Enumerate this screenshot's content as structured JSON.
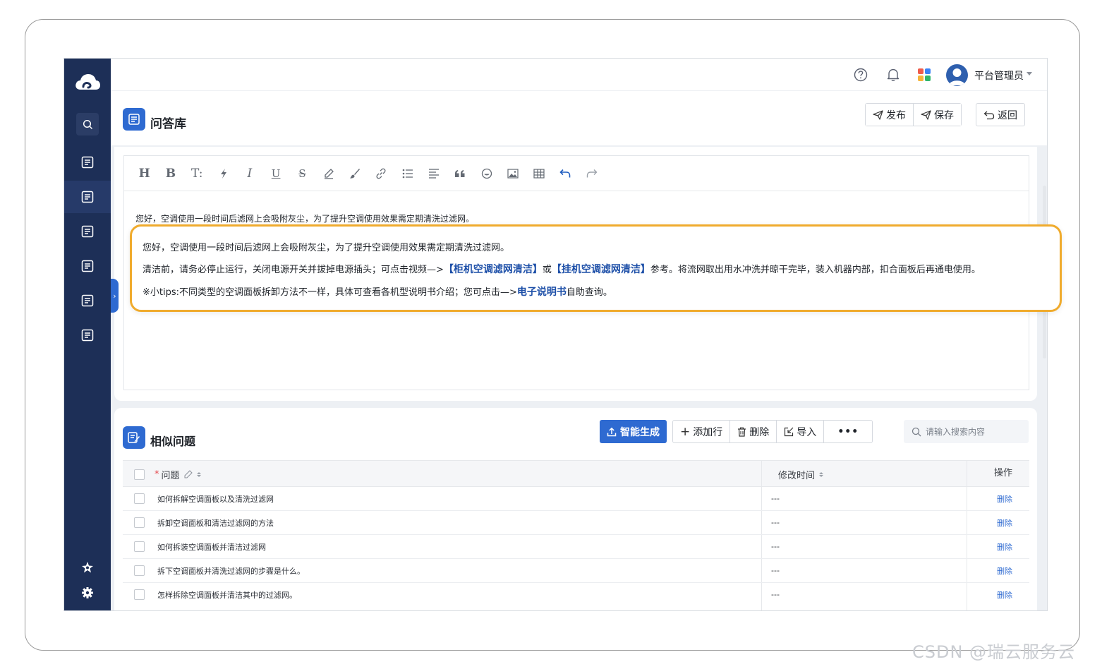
{
  "header": {
    "user_name": "平台管理员",
    "apps_colors": [
      "#ef5b4b",
      "#3b82f6",
      "#f5b43a",
      "#2fb56b"
    ]
  },
  "page": {
    "title": "问答库",
    "publish_label": "发布",
    "save_label": "保存",
    "back_label": "返回"
  },
  "editor": {
    "tools": [
      "H",
      "B",
      "T:",
      "",
      "I",
      "U",
      "S",
      "",
      "",
      "",
      "",
      "",
      "",
      "",
      "",
      "",
      "",
      ""
    ],
    "line1": "您好，空调使用一段时间后滤网上会吸附灰尘，为了提升空调使用效果需定期清洗过滤网。"
  },
  "callout": {
    "line1": "您好，空调使用一段时间后滤网上会吸附灰尘，为了提升空调使用效果需定期清洗过滤网。",
    "line2_pre": "清洁前，请务必停止运行，关闭电源开关并拔掉电源插头；可点击视频—>",
    "line2_link1": "【柜机空调滤网清洁】",
    "line2_mid": "或",
    "line2_link2": "【挂机空调滤网清洁】",
    "line2_post": "参考。将流网取出用水冲洗并晾干完毕，装入机器内部，扣合面板后再通电使用。",
    "line3_pre": "※小tips:不同类型的空调面板拆卸方法不一样，具体可查看各机型说明书介绍；您可点击—>",
    "line3_link": "电子说明书",
    "line3_post": "自助查询。"
  },
  "similar": {
    "title": "相似问题",
    "generate_label": "智能生成",
    "add_row_label": "添加行",
    "delete_label": "删除",
    "import_label": "导入",
    "more_label": "•••",
    "search_placeholder": "请输入搜索内容",
    "columns": {
      "required_mark": "*",
      "question": "问题",
      "modified": "修改时间",
      "action": "操作"
    },
    "rows": [
      {
        "question": "如何拆解空调面板以及清洗过滤网",
        "modified": "---",
        "action": "删除"
      },
      {
        "question": "拆卸空调面板和清洁过滤网的方法",
        "modified": "---",
        "action": "删除"
      },
      {
        "question": "如何拆装空调面板并清洁过滤网",
        "modified": "---",
        "action": "删除"
      },
      {
        "question": "拆下空调面板并清洗过滤网的步骤是什么。",
        "modified": "---",
        "action": "删除"
      },
      {
        "question": "怎样拆除空调面板并清洁其中的过滤网。",
        "modified": "---",
        "action": "删除"
      }
    ]
  },
  "watermark": "CSDN @瑞云服务云"
}
